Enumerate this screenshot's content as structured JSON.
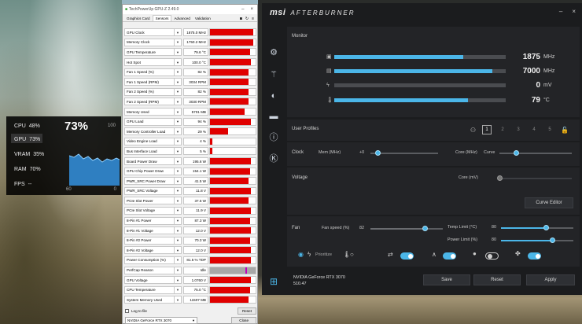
{
  "osd": {
    "cpu_label": "CPU",
    "cpu_val": "48%",
    "gpu_label": "GPU",
    "gpu_val": "73%",
    "vram_label": "VRAM",
    "vram_val": "35%",
    "ram_label": "RAM",
    "ram_val": "70%",
    "fps_label": "FPS",
    "fps_val": "--",
    "big_value": "73%",
    "max_value": "100",
    "axis_left": "60",
    "axis_right": "0"
  },
  "gpuz": {
    "title": "TechPowerUp GPU-Z 2.49.0",
    "tabs": [
      "Graphics Card",
      "Sensors",
      "Advanced",
      "Validation"
    ],
    "active_tab": "Sensors",
    "sensors": [
      {
        "name": "GPU Clock",
        "value": "1875.0 MHz",
        "fill": 0.95
      },
      {
        "name": "Memory Clock",
        "value": "1750.2 MHz",
        "fill": 0.95
      },
      {
        "name": "GPU Temperature",
        "value": "79.6 °C",
        "fill": 0.88
      },
      {
        "name": "Hot Spot",
        "value": "100.0 °C",
        "fill": 0.9
      },
      {
        "name": "Fan 1 Speed (%)",
        "value": "82 %",
        "fill": 0.85
      },
      {
        "name": "Fan 1 Speed (RPM)",
        "value": "3034 RPM",
        "fill": 0.85
      },
      {
        "name": "Fan 2 Speed (%)",
        "value": "82 %",
        "fill": 0.85
      },
      {
        "name": "Fan 2 Speed (RPM)",
        "value": "3030 RPM",
        "fill": 0.85
      },
      {
        "name": "Memory Used",
        "value": "5701 MB",
        "fill": 0.75
      },
      {
        "name": "GPU Load",
        "value": "94 %",
        "fill": 0.9
      },
      {
        "name": "Memory Controller Load",
        "value": "29 %",
        "fill": 0.4
      },
      {
        "name": "Video Engine Load",
        "value": "4 %",
        "fill": 0.05
      },
      {
        "name": "Bus Interface Load",
        "value": "5 %",
        "fill": 0.06
      },
      {
        "name": "Board Power Draw",
        "value": "195.6 W",
        "fill": 0.9
      },
      {
        "name": "GPU Chip Power Draw",
        "value": "154.1 W",
        "fill": 0.88
      },
      {
        "name": "PWR_SRC Power Draw",
        "value": "41.5 W",
        "fill": 0.85
      },
      {
        "name": "PWR_SRC Voltage",
        "value": "11.8 V",
        "fill": 0.9
      },
      {
        "name": "PCIe Slot Power",
        "value": "37.5 W",
        "fill": 0.85
      },
      {
        "name": "PCIe Slot Voltage",
        "value": "11.9 V",
        "fill": 0.9
      },
      {
        "name": "8-Pin #1 Power",
        "value": "87.3 W",
        "fill": 0.88
      },
      {
        "name": "8-Pin #1 Voltage",
        "value": "12.0 V",
        "fill": 0.9
      },
      {
        "name": "8-Pin #2 Power",
        "value": "70.3 W",
        "fill": 0.88
      },
      {
        "name": "8-Pin #2 Voltage",
        "value": "12.0 V",
        "fill": 0.9
      },
      {
        "name": "Power Consumption (%)",
        "value": "81.5 % TDP",
        "fill": 0.9
      },
      {
        "name": "PerfCap Reason",
        "value": "Idle",
        "fill": 1.0,
        "gray": true
      },
      {
        "name": "GPU Voltage",
        "value": "1.0760 V",
        "fill": 0.9
      },
      {
        "name": "CPU Temperature",
        "value": "75.0 °C",
        "fill": 0.88
      },
      {
        "name": "System Memory Used",
        "value": "11507 MB",
        "fill": 0.85
      }
    ],
    "log_to_file": "Log to file",
    "reset": "Reset",
    "device": "NVIDIA GeForce RTX 3070",
    "close": "Close"
  },
  "ab": {
    "logo": "msi",
    "logo_sub": "AFTERBURNER",
    "monitor_title": "Monitor",
    "monitor": [
      {
        "icon": "▣",
        "value": "1875",
        "unit": "MHz",
        "fill": 0.75
      },
      {
        "icon": "▤",
        "value": "7000",
        "unit": "MHz",
        "fill": 0.92
      },
      {
        "icon": "ϟ",
        "value": "0",
        "unit": "mV",
        "fill": 0.0
      },
      {
        "icon": "🌡",
        "value": "79",
        "unit": "°C",
        "fill": 0.78
      }
    ],
    "user_profiles": "User Profiles",
    "profiles": [
      "1",
      "2",
      "3",
      "4",
      "5"
    ],
    "clock_label": "Clock",
    "mem_label": "Mem (MHz)",
    "mem_value": "+0",
    "core_label": "Core (MHz)",
    "curve_label": "Curve",
    "voltage_label": "Voltage",
    "core_mv_label": "Core (mV)",
    "curve_editor": "Curve Editor",
    "fan_label": "Fan",
    "fan_speed_label": "Fan speed (%)",
    "fan_speed_value": "82",
    "temp_limit_label": "Temp Limit (°C)",
    "temp_limit_value": "80",
    "power_limit_label": "Power Limit (%)",
    "power_limit_value": "80",
    "prioritize": "Prioritize",
    "gpu_name": "NVIDIA GeForce RTX 3070",
    "gpu_driver": "510.47",
    "save": "Save",
    "reset": "Reset",
    "apply": "Apply"
  }
}
